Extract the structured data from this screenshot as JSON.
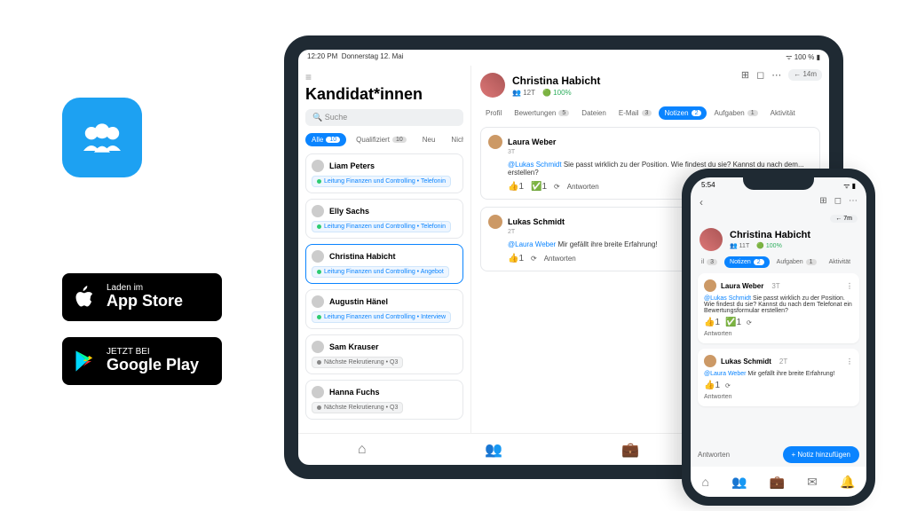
{
  "appstore": {
    "small": "Laden im",
    "big": "App Store"
  },
  "playstore": {
    "small": "JETZT BEI",
    "big": "Google Play"
  },
  "tablet": {
    "status_time": "12:20 PM",
    "status_date": "Donnerstag 12. Mai",
    "status_right": "100 %",
    "title": "Kandidat*innen",
    "search_placeholder": "Suche",
    "tabs": [
      {
        "label": "Alle",
        "count": "10",
        "active": true
      },
      {
        "label": "Qualifiziert",
        "count": "10"
      },
      {
        "label": "Neu",
        "count": ""
      },
      {
        "label": "Nicht kont",
        "count": ""
      }
    ],
    "candidates": [
      {
        "name": "Liam Peters",
        "pill": "Leitung Finanzen und Controlling • Telefonin",
        "type": "blue"
      },
      {
        "name": "Elly Sachs",
        "pill": "Leitung Finanzen und Controlling • Telefonin",
        "type": "blue"
      },
      {
        "name": "Christina Habicht",
        "pill": "Leitung Finanzen und Controlling • Angebot",
        "type": "blue",
        "sel": true
      },
      {
        "name": "Augustin Hänel",
        "pill": "Leitung Finanzen und Controlling • Interview",
        "type": "blue"
      },
      {
        "name": "Sam Krauser",
        "pill": "Nächste Rekrutierung • Q3",
        "type": "grey"
      },
      {
        "name": "Hanna Fuchs",
        "pill": "Nächste Rekrutierung • Q3",
        "type": "grey"
      }
    ],
    "profile": {
      "name": "Christina Habicht",
      "meta_days": "12T",
      "meta_fit": "100%",
      "time_pill": "14m"
    },
    "ptabs": [
      {
        "label": "Profil"
      },
      {
        "label": "Bewertungen",
        "b": "5"
      },
      {
        "label": "Dateien"
      },
      {
        "label": "E-Mail",
        "b": "3"
      },
      {
        "label": "Notizen",
        "b": "2",
        "active": true
      },
      {
        "label": "Aufgaben",
        "b": "1"
      },
      {
        "label": "Aktivität"
      }
    ],
    "notes": [
      {
        "author": "Laura Weber",
        "time": "3T",
        "mention": "@Lukas Schmidt",
        "body": "Sie passt wirklich zu der Position. Wie findest du sie? Kannst du nach dem... erstellen?",
        "r1": "👍1",
        "r2": "✅1",
        "reply": "Antworten"
      },
      {
        "author": "Lukas Schmidt",
        "time": "2T",
        "mention": "@Laura Weber",
        "body": "Mir gefällt ihre breite Erfahrung!",
        "r1": "👍1",
        "reply": "Antworten"
      }
    ]
  },
  "phone": {
    "status_time": "5:54",
    "time_pill": "7m",
    "profile": {
      "name": "Christina Habicht",
      "meta_days": "11T",
      "meta_fit": "100%"
    },
    "tabs": [
      {
        "label": "il",
        "b": "3"
      },
      {
        "label": "Notizen",
        "b": "2",
        "active": true
      },
      {
        "label": "Aufgaben",
        "b": "1"
      },
      {
        "label": "Aktivität"
      }
    ],
    "notes": [
      {
        "author": "Laura Weber",
        "time": "3T",
        "mention": "@Lukas Schmidt",
        "body": "Sie passt wirklich zu der Position. Wie findest du sie? Kannst du nach dem Telefonat ein Bewertungsformular erstellen?",
        "r1": "👍1",
        "r2": "✅1",
        "reply": "Antworten"
      },
      {
        "author": "Lukas Schmidt",
        "time": "2T",
        "mention": "@Laura Weber",
        "body": "Mir gefällt ihre breite Erfahrung!",
        "r1": "👍1",
        "reply": "Antworten"
      }
    ],
    "answer": "Antworten",
    "add_note": "+ Notiz hinzufügen"
  }
}
